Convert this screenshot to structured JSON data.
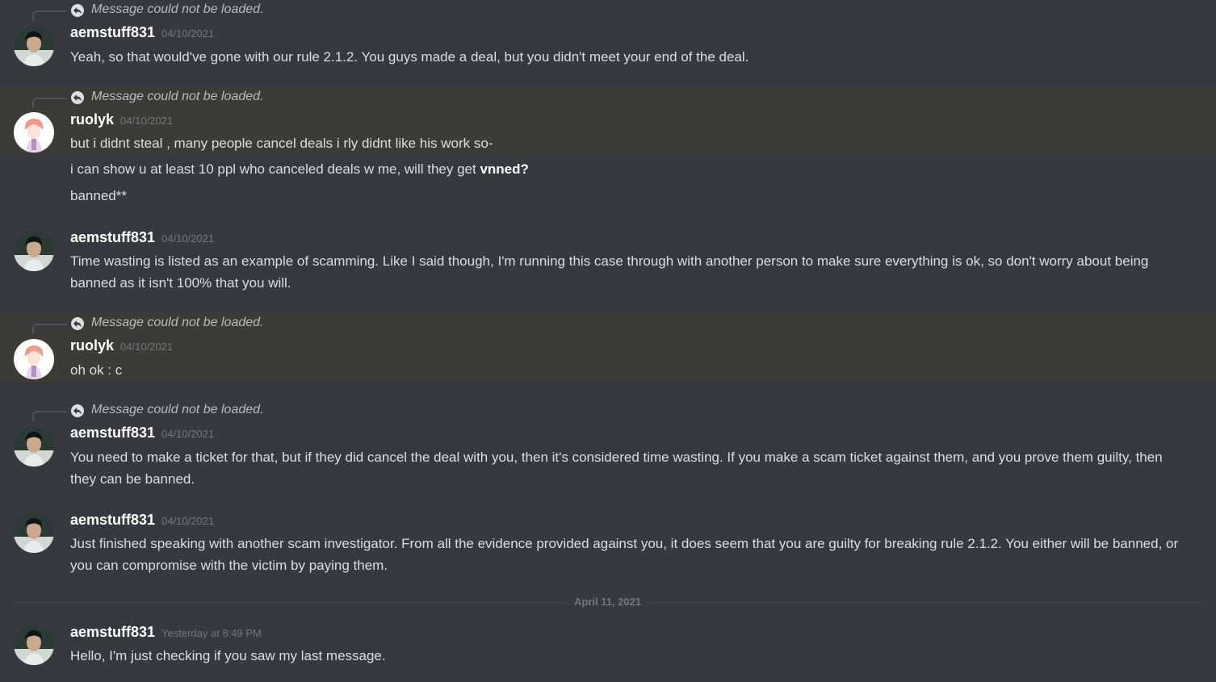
{
  "reply_placeholder": "Message could not be loaded.",
  "groups": [
    {
      "username": "aemstuff831",
      "timestamp": "04/10/2021",
      "messages": [
        "Yeah, so that would've gone with our rule 2.1.2. You guys made a deal, but you didn't meet your end of the deal."
      ]
    },
    {
      "username": "ruolyk",
      "timestamp": "04/10/2021",
      "messages": [
        "but i didnt steal , many people cancel deals i rly didnt like his work so-",
        "i can show u at least 10 ppl who canceled deals w me, will they get ",
        "banned**"
      ],
      "bold_fragment": "vnned?"
    },
    {
      "username": "aemstuff831",
      "timestamp": "04/10/2021",
      "messages": [
        "Time wasting is listed as an example of scamming. Like I said though, I'm running this case through with another person to make sure everything is ok, so don't worry about being banned as it isn't 100% that you will."
      ]
    },
    {
      "username": "ruolyk",
      "timestamp": "04/10/2021",
      "messages": [
        "oh ok : c"
      ]
    },
    {
      "username": "aemstuff831",
      "timestamp": "04/10/2021",
      "messages": [
        "You need to make a ticket for that, but if they did cancel the deal with you, then it's considered time wasting. If you make a scam ticket against them, and you prove them guilty, then they can be banned."
      ]
    },
    {
      "username": "aemstuff831",
      "timestamp": "04/10/2021",
      "messages": [
        "Just finished speaking with another scam investigator. From all the evidence provided against you, it does seem that you are guilty for breaking rule 2.1.2. You either will be banned, or you can compromise with the victim by paying them."
      ]
    },
    {
      "username": "aemstuff831",
      "timestamp": "Yesterday at 8:49 PM",
      "messages": [
        "Hello, I'm just checking if you saw my last message."
      ]
    }
  ],
  "date_divider": "April 11, 2021",
  "colors": {
    "background": "#36393f",
    "highlight": "#3c3b37",
    "username": "#ffffff",
    "text": "#dcddde",
    "muted": "#72767d"
  }
}
